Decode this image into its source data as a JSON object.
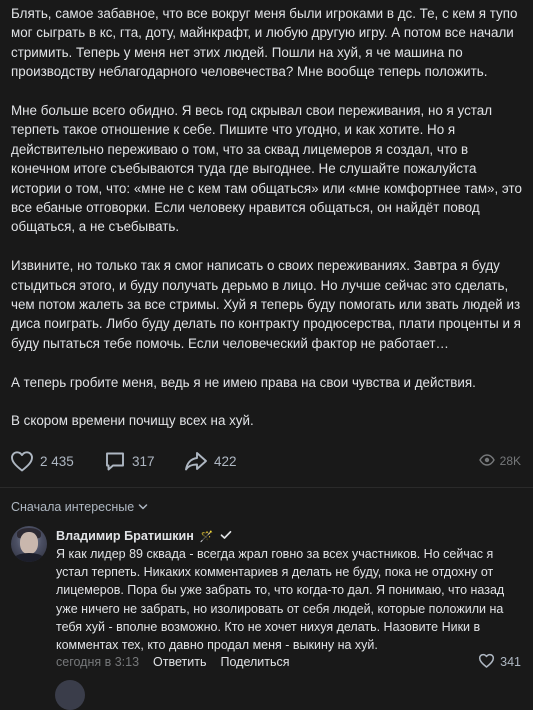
{
  "post": {
    "paragraphs": [
      "Блять, самое забавное, что все вокруг меня были игроками в дс. Те, с кем я тупо мог сыграть в кс, гта, доту, майнкрафт, и любую другую игру. А потом все начали стримить. Теперь у меня нет этих людей. Пошли на хуй, я че машина по производству неблагодарного человечества? Мне вообще теперь положить.",
      "Мне больше всего обидно. Я весь год скрывал свои переживания, но я устал терпеть такое отношение к себе. Пишите что угодно, и как хотите. Но я действительно переживаю о том, что за сквад лицемеров я создал, что в конечном итоге съебываются туда где выгоднее. Не слушайте пожалуйста истории о том, что: «мне не с кем там общаться» или «мне комфортнее там», это все ебаные отговорки. Если человеку нравится общаться, он найдёт повод общаться, а не съебывать.",
      "Извините, но только так я смог написать о своих переживаниях. Завтра я буду стыдиться этого, и буду получать дерьмо в лицо. Но лучше сейчас это сделать, чем потом жалеть за все стримы. Хуй я теперь буду помогать или звать людей из диса поиграть. Либо буду делать по контракту продюсерства, плати проценты и я буду пытаться тебе помочь. Если человеческий фактор не работает…",
      "А теперь гробите меня, ведь я не имею права на свои чувства и действия.",
      "В скором времени почищу всех на хуй."
    ],
    "likes": "2 435",
    "comments": "317",
    "shares": "422",
    "views": "28K"
  },
  "comments_section": {
    "sort_label": "Сначала интересные"
  },
  "comment": {
    "author": "Владимир Братишкин",
    "author_badge_emoji": "🪄",
    "text": "Я как лидер 89 сквада - всегда жрал говно за всех участников. Но сейчас я устал терпеть. Никаких комментариев я делать не буду, пока не отдохну от лицемеров. Пора бы уже забрать то, что когда-то дал. Я понимаю, что назад уже ничего не забрать, но изолировать от себя людей, которые положили на тебя хуй - вполне возможно. Кто не хочет нихуя делать. Назовите Ники в комментах тех, кто давно продал меня - выкину на хуй.",
    "time": "сегодня в 3:13",
    "reply_label": "Ответить",
    "share_label": "Поделиться",
    "likes": "341"
  },
  "icons": {
    "like": "heart-icon",
    "comment": "comment-bubble-icon",
    "share": "share-arrow-icon",
    "views": "eye-icon",
    "sort": "chevron-down-icon",
    "verified": "checkmark-icon"
  },
  "colors": {
    "background": "#191919",
    "text": "#e1e3e6",
    "secondary": "#aeb7c2",
    "muted": "#76787a"
  }
}
